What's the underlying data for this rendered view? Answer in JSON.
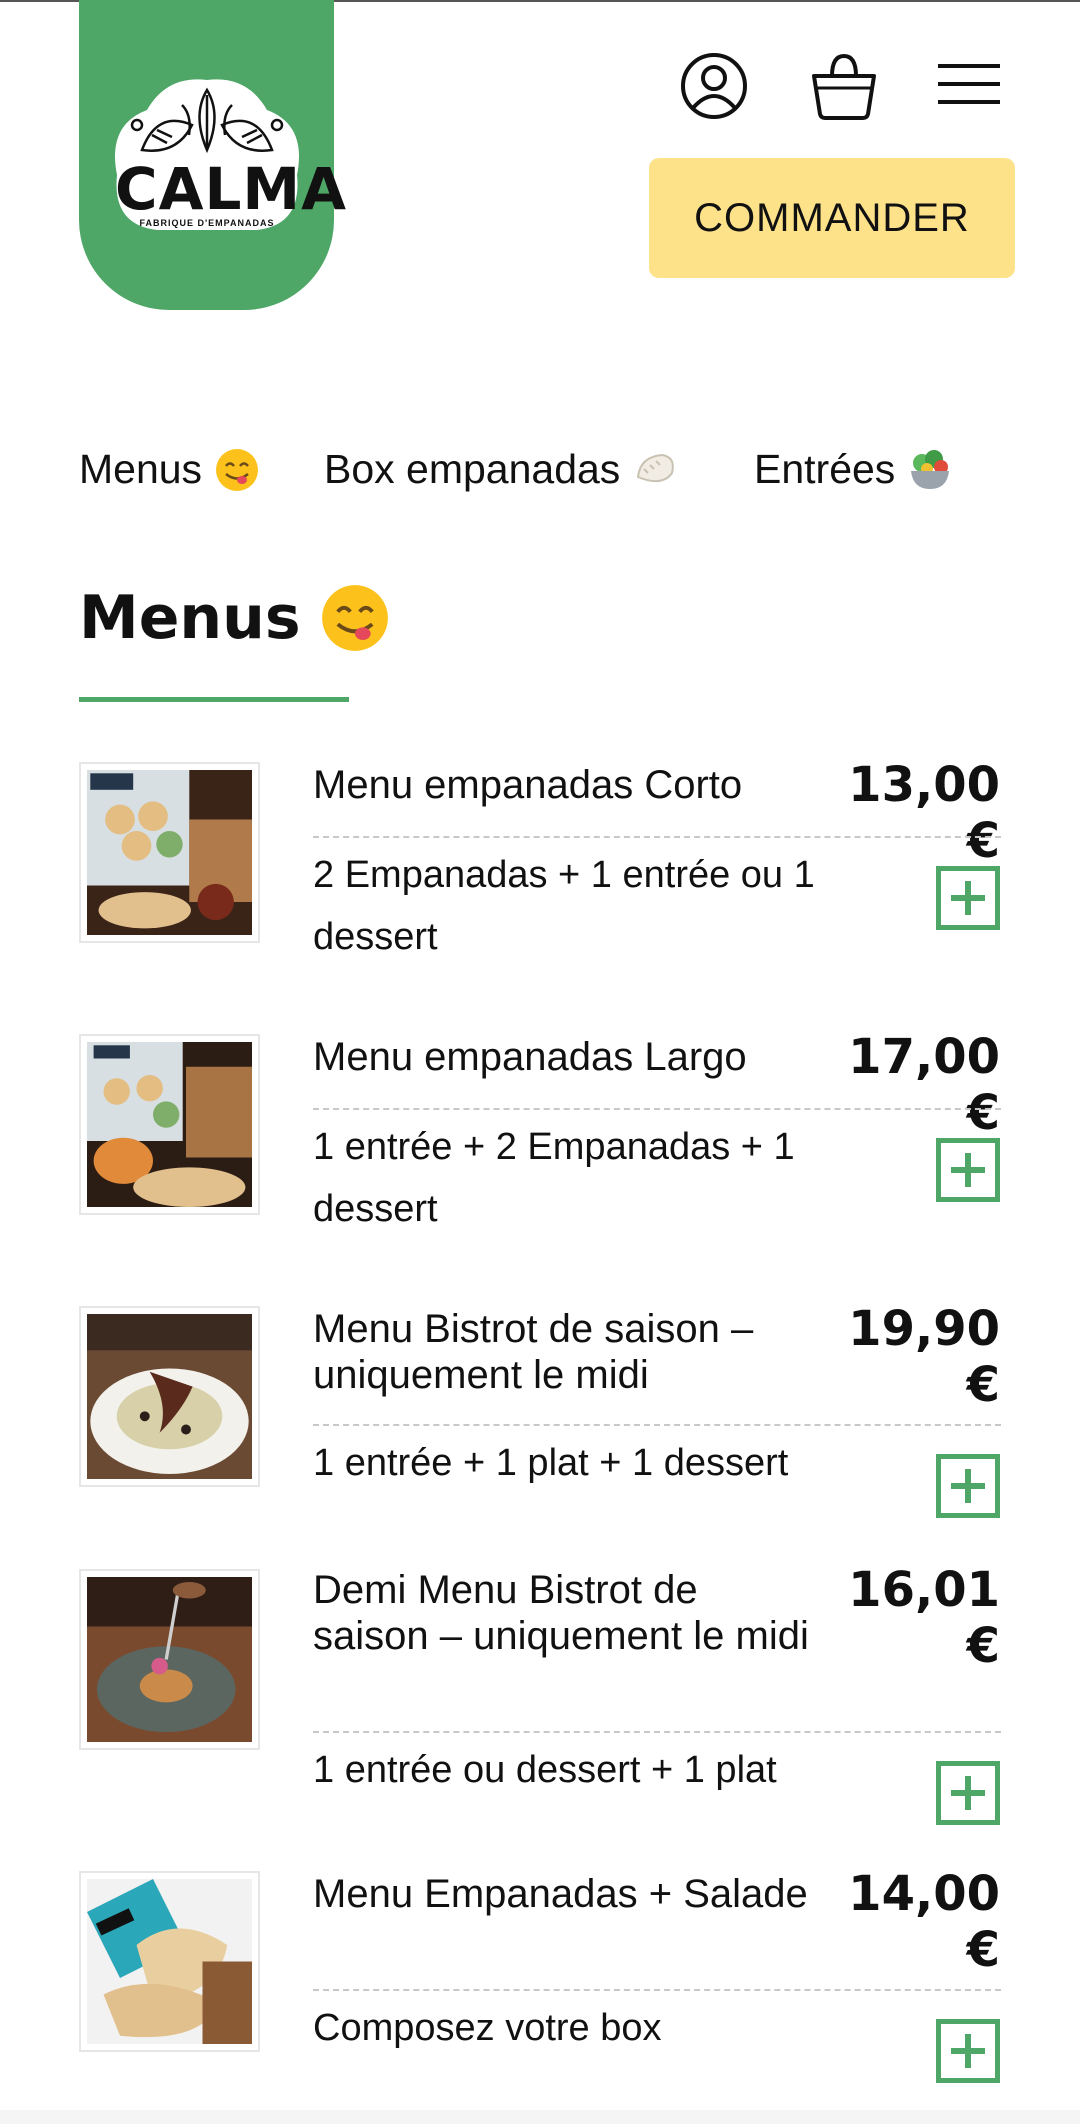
{
  "header": {
    "logo_word": "CALMA",
    "logo_sub": "FABRIQUE D'EMPANADAS",
    "order_button": "COMMANDER",
    "icons": [
      "account-icon",
      "shopping-basket-icon",
      "hamburger-menu-icon"
    ]
  },
  "categories": [
    {
      "label": "Menus",
      "emoji": "face-savoring-food"
    },
    {
      "label": "Box empanadas",
      "emoji": "dumpling"
    },
    {
      "label": "Entrées",
      "emoji": "green-salad"
    }
  ],
  "section": {
    "title": "Menus",
    "emoji": "face-savoring-food"
  },
  "colors": {
    "brand_green": "#4ea667",
    "cta_yellow": "#fde28a"
  },
  "items": [
    {
      "name": "Menu empanadas Corto",
      "price": "13,00 €",
      "description": "2 Empanadas + 1 entrée ou 1 dessert"
    },
    {
      "name": "Menu empanadas Largo",
      "price": "17,00 €",
      "description": "1 entrée + 2 Empanadas + 1 dessert"
    },
    {
      "name": "Menu Bistrot de saison – uniquement le midi",
      "price": "19,90 €",
      "description": "1 entrée + 1 plat + 1 dessert"
    },
    {
      "name": "Demi Menu Bistrot de saison – uniquement le midi",
      "price": "16,01 €",
      "description": "1 entrée ou dessert + 1 plat"
    },
    {
      "name": "Menu Empanadas + Salade",
      "price": "14,00 €",
      "description": "Composez votre box"
    }
  ]
}
